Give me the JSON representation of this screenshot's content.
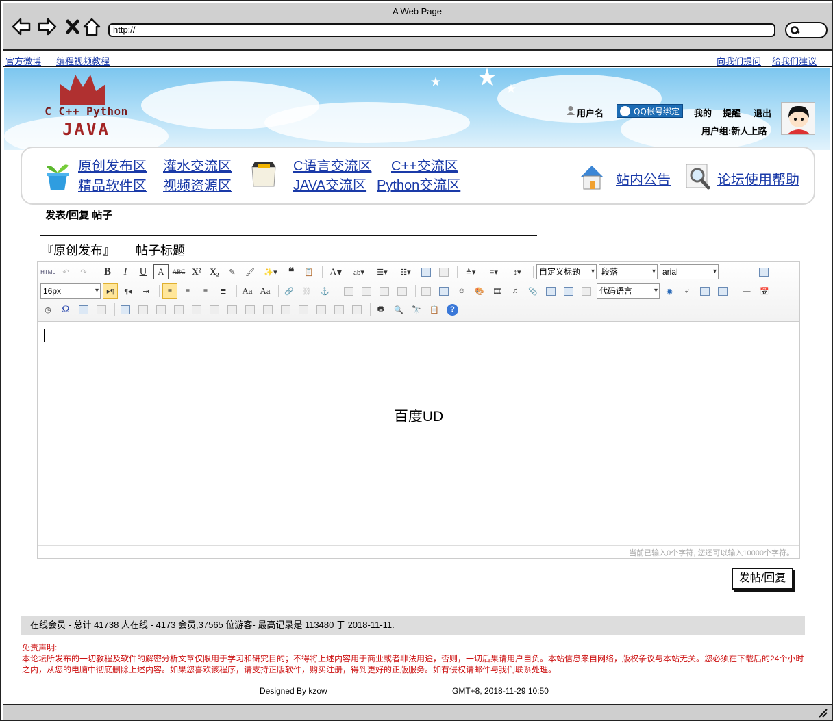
{
  "window": {
    "title": "A Web Page",
    "url": "http://"
  },
  "linkbar": {
    "left": [
      "官方微博",
      "编程视频教程"
    ],
    "right": [
      "向我们提问",
      "给我们建议"
    ]
  },
  "logo": {
    "line1": "C C++ Python",
    "line2": "JAVA"
  },
  "user": {
    "username": "用户名",
    "qq_bind": "QQ帐号绑定",
    "mine": "我的",
    "remind": "提醒",
    "logout": "退出",
    "group": "用户组:新人上路"
  },
  "nav": {
    "group1": [
      "原创发布区",
      "灌水交流区",
      "精品软件区",
      "视频资源区"
    ],
    "group2": [
      "C语言交流区",
      "C++交流区",
      "JAVA交流区",
      "Python交流区"
    ],
    "announcements": "站内公告",
    "help": "论坛使用帮助"
  },
  "section_title": "发表/回复 帖子",
  "post": {
    "forum": "『原创发布』",
    "subject_label": "帖子标题"
  },
  "editor": {
    "title_style": "自定义标题",
    "paragraph": "段落",
    "font": "arial",
    "font_size": "16px",
    "code_lang": "代码语言",
    "center_text": "百度UD",
    "counter": "当前已输入0个字符, 您还可以输入10000个字符。"
  },
  "submit_label": "发帖/回复",
  "stats": "在线会员 - 总计 41738 人在线 - 4173 会员,37565 位游客- 最高记录是 113480 于 2018-11-11.",
  "disclaimer": {
    "title": "免责声明:",
    "body": "本论坛所发布的一切教程及软件的解密分析文章仅限用于学习和研究目的；不得将上述内容用于商业或者非法用途，否则，一切后果请用户自负。本站信息来自网络，版权争议与本站无关。您必须在下载后的24个小时之内，从您的电脑中彻底删除上述内容。如果您喜欢该程序，请支持正版软件，购买注册，得到更好的正版服务。如有侵权请邮件与我们联系处理。"
  },
  "footer": {
    "designed": "Designed By kzow",
    "time": "GMT+8, 2018-11-29 10:50"
  },
  "colors": {
    "link": "#1a3aa8",
    "disclaimer": "#cc1111",
    "qq_badge": "#1c6cb4",
    "logo": "#a32424"
  }
}
